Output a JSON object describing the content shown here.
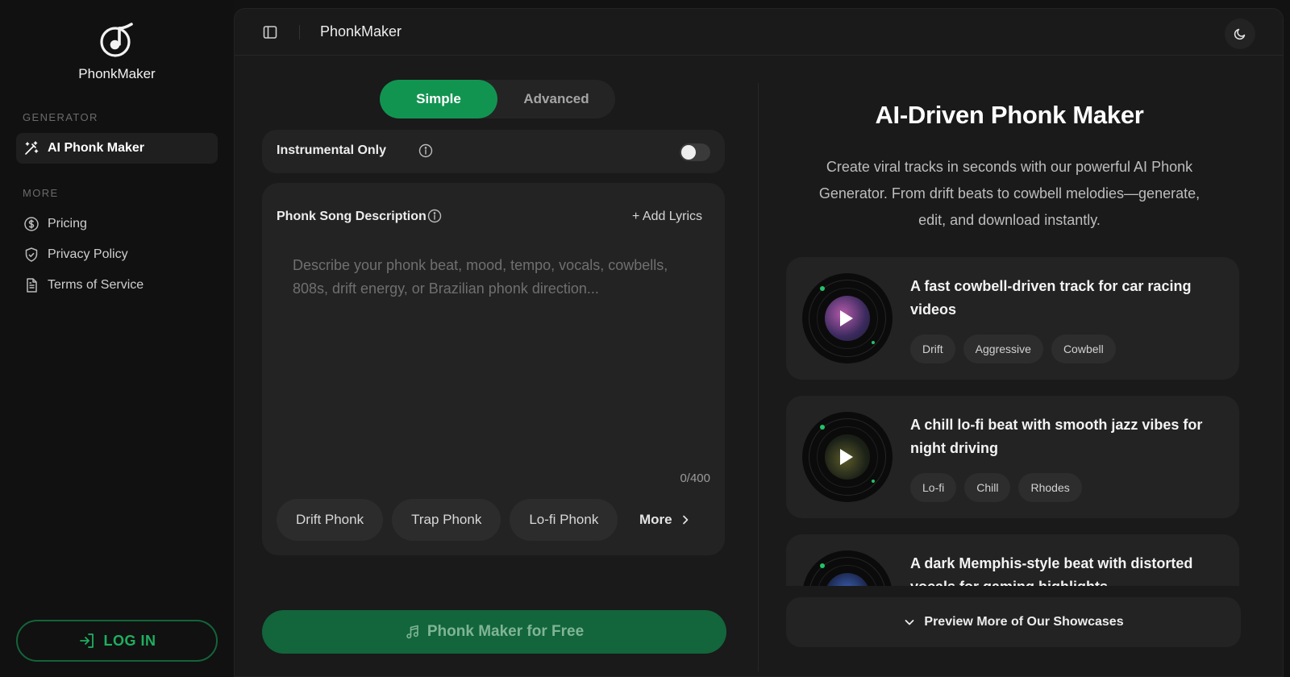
{
  "brand": {
    "name": "PhonkMaker"
  },
  "sidebar": {
    "generator_label": "GENERATOR",
    "more_label": "MORE",
    "generator_item": "AI Phonk Maker",
    "more_items": [
      {
        "label": "Pricing",
        "icon": "dollar-circle-icon"
      },
      {
        "label": "Privacy Policy",
        "icon": "shield-check-icon"
      },
      {
        "label": "Terms of Service",
        "icon": "document-icon"
      }
    ],
    "login_label": "LOG IN"
  },
  "topbar": {
    "title": "PhonkMaker"
  },
  "form": {
    "mode_simple": "Simple",
    "mode_advanced": "Advanced",
    "instrumental_label": "Instrumental Only",
    "instrumental_on": false,
    "description_label": "Phonk Song Description",
    "add_lyrics": "+ Add Lyrics",
    "description_placeholder": "Describe your phonk beat, mood, tempo, vocals, cowbells, 808s, drift energy, or Brazilian phonk direction...",
    "description_value": "",
    "char_count": "0/400",
    "chips": [
      "Drift Phonk",
      "Trap Phonk",
      "Lo-fi Phonk"
    ],
    "more_label": "More",
    "generate_label": "Phonk Maker for Free"
  },
  "hero": {
    "title": "AI-Driven Phonk Maker",
    "subtitle": "Create viral tracks in seconds with our powerful AI Phonk Generator. From drift beats to cowbell melodies—generate, edit, and download instantly."
  },
  "showcases": [
    {
      "title": "A fast cowbell-driven track for car racing videos",
      "tags": [
        "Drift",
        "Aggressive",
        "Cowbell"
      ]
    },
    {
      "title": "A chill lo-fi beat with smooth jazz vibes for night driving",
      "tags": [
        "Lo-fi",
        "Chill",
        "Rhodes"
      ]
    },
    {
      "title": "A dark Memphis-style beat with distorted vocals for gaming highlights",
      "tags": []
    }
  ],
  "preview_more": "Preview More of Our Showcases",
  "colors": {
    "accent": "#129451",
    "accent_dark": "#13653b",
    "login_text": "#1fae60"
  }
}
